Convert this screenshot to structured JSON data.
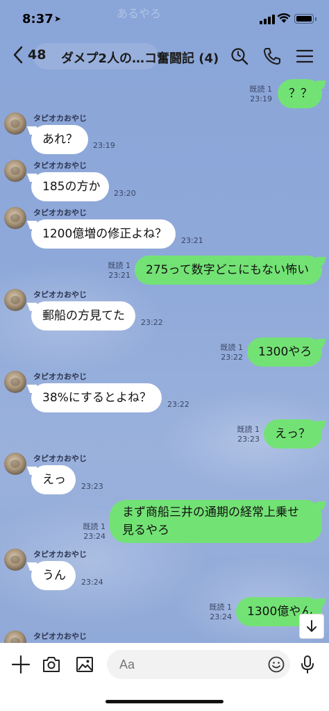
{
  "status_bar": {
    "time": "8:37",
    "ghost_text": "あるやろ"
  },
  "header": {
    "back_count": "48",
    "title": "ダメプ2人の…コ奮闘記 (4)"
  },
  "messages": [
    {
      "side": "out",
      "text": "？？",
      "read": "既読 1",
      "time": "23:19"
    },
    {
      "side": "in",
      "sender": "タピオカおやじ",
      "text": "あれ？",
      "time": "23:19"
    },
    {
      "side": "in",
      "sender": "タピオカおやじ",
      "text": "185の方か",
      "time": "23:20"
    },
    {
      "side": "in",
      "sender": "タピオカおやじ",
      "text": "1200億増の修正よね？",
      "time": "23:21"
    },
    {
      "side": "out",
      "text": "275って数字どこにもない怖い",
      "read": "既読 1",
      "time": "23:21"
    },
    {
      "side": "in",
      "sender": "タピオカおやじ",
      "text": "郵船の方見てた",
      "time": "23:22"
    },
    {
      "side": "out",
      "text": "1300やろ",
      "read": "既読 1",
      "time": "23:22"
    },
    {
      "side": "in",
      "sender": "タピオカおやじ",
      "text": "38%にするとよね？",
      "time": "23:22"
    },
    {
      "side": "out",
      "text": "えっ？",
      "read": "既読 1",
      "time": "23:23"
    },
    {
      "side": "in",
      "sender": "タピオカおやじ",
      "text": "えっ",
      "time": "23:23"
    },
    {
      "side": "out",
      "text": "まず商船三井の通期の経常上乗せ見るやろ",
      "read": "既読 1",
      "time": "23:24"
    },
    {
      "side": "in",
      "sender": "タピオカおやじ",
      "text": "うん",
      "time": "23:24"
    },
    {
      "side": "out",
      "text": "1300億やん",
      "read": "既読 1",
      "time": "23:24"
    },
    {
      "side": "in",
      "sender": "タピオカおやじ",
      "text": "",
      "time": ""
    }
  ],
  "input": {
    "placeholder": "Aa"
  },
  "icons": {
    "back": "chevron-left-icon",
    "search": "search-icon",
    "call": "phone-icon",
    "menu": "menu-icon",
    "add": "plus-icon",
    "camera": "camera-icon",
    "image": "image-icon",
    "emoji": "emoji-icon",
    "mic": "mic-icon",
    "scroll": "arrow-down-icon"
  },
  "colors": {
    "chat_bg": "#8aa5d8",
    "outgoing_bubble": "#73e275",
    "incoming_bubble": "#ffffff"
  }
}
